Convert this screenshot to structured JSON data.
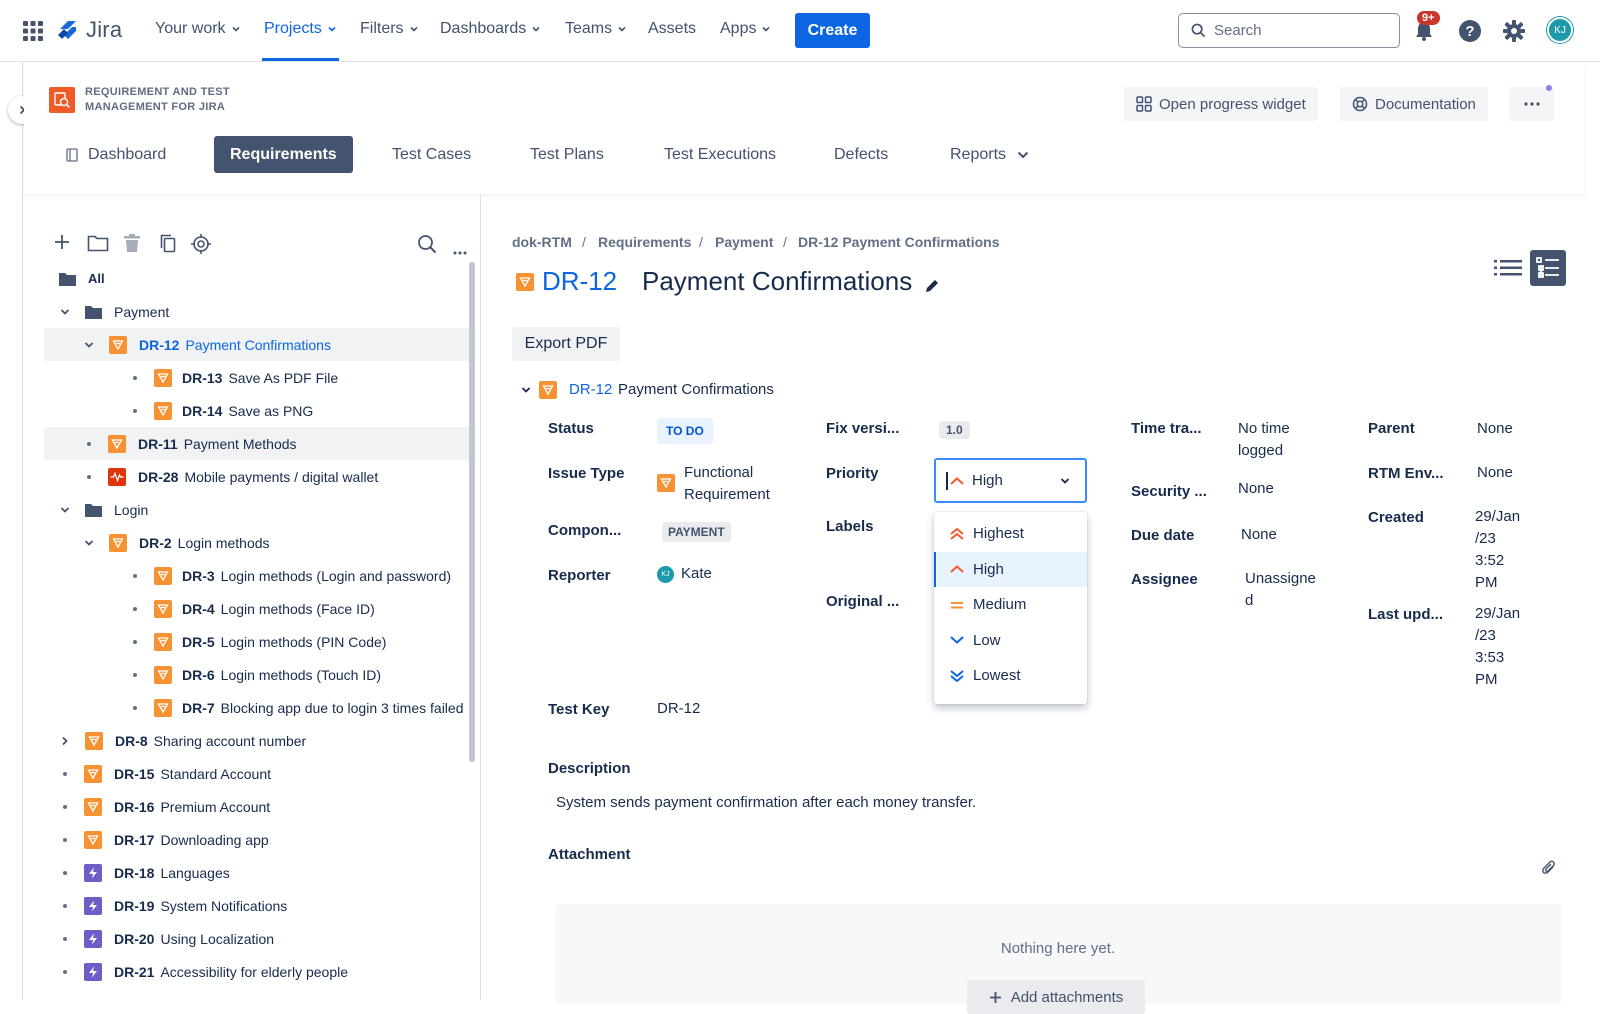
{
  "topnav": {
    "brand": "Jira",
    "links": [
      {
        "label": "Your work",
        "chevron": true
      },
      {
        "label": "Projects",
        "chevron": true,
        "active": true
      },
      {
        "label": "Filters",
        "chevron": true
      },
      {
        "label": "Dashboards",
        "chevron": true
      },
      {
        "label": "Teams",
        "chevron": true
      },
      {
        "label": "Assets",
        "chevron": false
      },
      {
        "label": "Apps",
        "chevron": true
      }
    ],
    "create_label": "Create",
    "search_placeholder": "Search",
    "notifications_badge": "9+",
    "avatar_initials": "KJ"
  },
  "app_header": {
    "app_name": "REQUIREMENT AND TEST MANAGEMENT FOR JIRA",
    "open_progress_widget": "Open progress widget",
    "documentation": "Documentation",
    "tabs": [
      "Dashboard",
      "Requirements",
      "Test Cases",
      "Test Plans",
      "Test Executions",
      "Defects",
      "Reports"
    ],
    "active_tab": "Requirements"
  },
  "tree": {
    "root_label": "All",
    "rows": [
      {
        "type": "folder",
        "label": "Payment"
      },
      {
        "key": "DR-12",
        "title": "Payment Confirmations",
        "icon": "requirement-icon"
      },
      {
        "key": "DR-13",
        "title": "Save As PDF File",
        "icon": "requirement-icon"
      },
      {
        "key": "DR-14",
        "title": "Save as PNG",
        "icon": "requirement-icon"
      },
      {
        "key": "DR-11",
        "title": "Payment Methods",
        "icon": "requirement-icon"
      },
      {
        "key": "DR-28",
        "title": "Mobile payments / digital wallet",
        "icon": "defect-icon"
      },
      {
        "type": "folder",
        "label": "Login"
      },
      {
        "key": "DR-2",
        "title": "Login methods",
        "icon": "requirement-icon"
      },
      {
        "key": "DR-3",
        "title": "Login methods (Login and password)",
        "icon": "requirement-icon"
      },
      {
        "key": "DR-4",
        "title": "Login methods (Face ID)",
        "icon": "requirement-icon"
      },
      {
        "key": "DR-5",
        "title": "Login methods (PIN Code)",
        "icon": "requirement-icon"
      },
      {
        "key": "DR-6",
        "title": "Login methods (Touch ID)",
        "icon": "requirement-icon"
      },
      {
        "key": "DR-7",
        "title": "Blocking app due to login 3 times failed",
        "icon": "requirement-icon"
      },
      {
        "key": "DR-8",
        "title": "Sharing account number",
        "icon": "requirement-icon"
      },
      {
        "key": "DR-15",
        "title": "Standard Account",
        "icon": "requirement-icon"
      },
      {
        "key": "DR-16",
        "title": "Premium Account",
        "icon": "requirement-icon"
      },
      {
        "key": "DR-17",
        "title": "Downloading app",
        "icon": "requirement-icon"
      },
      {
        "key": "DR-18",
        "title": "Languages",
        "icon": "epic-icon"
      },
      {
        "key": "DR-19",
        "title": "System Notifications",
        "icon": "epic-icon"
      },
      {
        "key": "DR-20",
        "title": "Using Localization",
        "icon": "epic-icon"
      },
      {
        "key": "DR-21",
        "title": "Accessibility for elderly people",
        "icon": "epic-icon"
      }
    ]
  },
  "breadcrumbs": [
    "dok-RTM",
    "Requirements",
    "Payment",
    "DR-12 Payment Confirmations"
  ],
  "issue": {
    "key": "DR-12",
    "title": "Payment Confirmations",
    "export_pdf": "Export PDF",
    "section_key": "DR-12",
    "section_title": "Payment Confirmations",
    "fields": {
      "status_label": "Status",
      "status_value": "TO DO",
      "issue_type_label": "Issue Type",
      "issue_type_value_1": "Functional",
      "issue_type_value_2": "Requirement",
      "components_label": "Compon...",
      "components_value": "PAYMENT",
      "reporter_label": "Reporter",
      "reporter_value": "Kate",
      "reporter_initials": "KJ",
      "fix_version_label": "Fix versi...",
      "fix_version_value": "1.0",
      "priority_label": "Priority",
      "priority_value": "High",
      "labels_label": "Labels",
      "original_label": "Original ...",
      "time_tracking_label": "Time tra...",
      "time_tracking_value_1": "No time",
      "time_tracking_value_2": "logged",
      "security_label": "Security ...",
      "security_value": "None",
      "due_date_label": "Due date",
      "due_date_value": "None",
      "assignee_label": "Assignee",
      "assignee_value_1": "Unassigne",
      "assignee_value_2": "d",
      "parent_label": "Parent",
      "parent_value": "None",
      "rtm_env_label": "RTM Env...",
      "rtm_env_value": "None",
      "created_label": "Created",
      "created_value": [
        "29/Jan",
        "/23",
        "3:52",
        "PM"
      ],
      "last_updated_label": "Last upd...",
      "last_updated_value": [
        "29/Jan",
        "/23",
        "3:53",
        "PM"
      ],
      "test_key_label": "Test Key",
      "test_key_value": "DR-12"
    },
    "priority_options": [
      "Highest",
      "High",
      "Medium",
      "Low",
      "Lowest"
    ],
    "priority_highlighted": "High",
    "description_label": "Description",
    "description_text": "System sends payment confirmation after each money transfer.",
    "attachment_label": "Attachment",
    "attachment_empty": "Nothing here yet.",
    "add_attachments": "Add attachments"
  },
  "colors": {
    "accent": "#0c66e4",
    "requirement": "#f79232",
    "epic": "#6e5dc6",
    "defect": "#de350b",
    "tab_active": "#44546f"
  }
}
